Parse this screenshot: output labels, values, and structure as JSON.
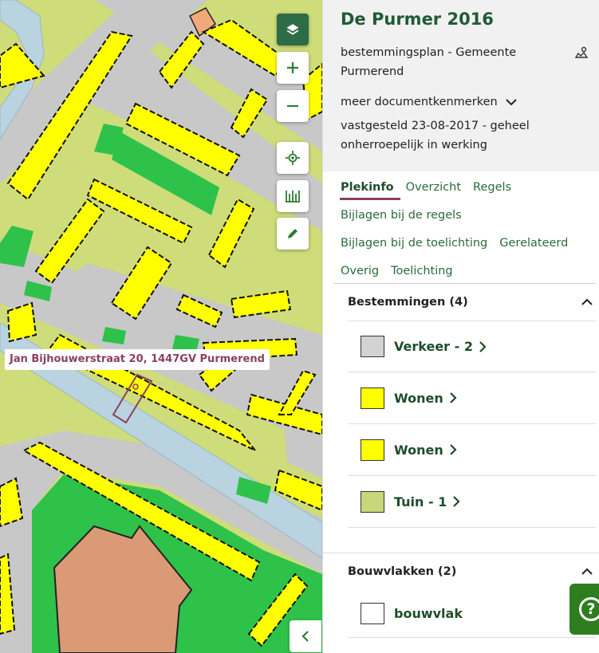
{
  "map": {
    "address_label": "Jan Bijhouwerstraat 20, 1447GV Purmerend",
    "controls": [
      {
        "name": "layers-button",
        "icon": "layers-icon"
      },
      {
        "name": "zoom-in-button",
        "icon": "plus-icon"
      },
      {
        "name": "zoom-out-button",
        "icon": "minus-icon"
      },
      {
        "name": "locate-button",
        "icon": "crosshair-icon"
      },
      {
        "name": "measure-button",
        "icon": "ruler-icon"
      },
      {
        "name": "draw-button",
        "icon": "pencil-icon"
      }
    ],
    "collapse_icon": "chevron-left-icon"
  },
  "plan": {
    "title": "De Purmer 2016",
    "type": "bestemmingsplan - Gemeente Purmerend",
    "type_icon": "map-pin-icon",
    "meta_toggle": "meer documentkenmerken",
    "status": "vastgesteld 23-08-2017 - geheel onherroepelijk in werking"
  },
  "tabs": {
    "row1": [
      "Plekinfo",
      "Overzicht",
      "Regels"
    ],
    "row2": [
      "Bijlagen bij de regels"
    ],
    "row3": [
      "Bijlagen bij de toelichting",
      "Gerelateerd"
    ],
    "row4": [
      "Overig",
      "Toelichting"
    ],
    "active": "Plekinfo"
  },
  "bestemmingen": {
    "title": "Bestemmingen (4)",
    "items": [
      {
        "label": "Verkeer - 2",
        "color": "#d3d3d3"
      },
      {
        "label": "Wonen",
        "color": "#ffff00"
      },
      {
        "label": "Wonen",
        "color": "#ffff00"
      },
      {
        "label": "Tuin - 1",
        "color": "#c8d77a"
      }
    ]
  },
  "bouwvlakken": {
    "title": "Bouwvlakken (2)",
    "items": [
      {
        "label": "bouwvlak",
        "color": "#ffffff"
      }
    ]
  },
  "help": {
    "icon": "help-icon",
    "symbol": "?"
  },
  "colors": {
    "accent": "#8a4060",
    "brand_green": "#1f5a36",
    "verkeer": "#c8c8c8",
    "wonen": "#ffff00",
    "tuin": "#cfdc7a",
    "groen": "#2ec24a",
    "water": "#b9d3e0",
    "maatschappelijk": "#d99a75"
  }
}
